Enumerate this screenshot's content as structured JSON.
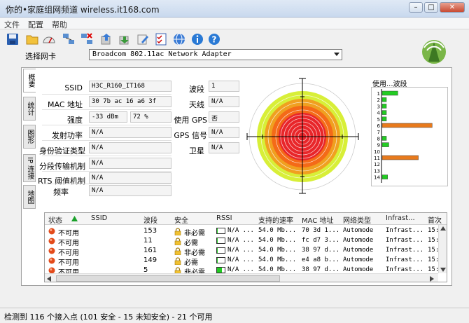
{
  "window": {
    "title": "你的•家庭组网频道 wireless.it168.com",
    "buttons": [
      "–",
      "□",
      "✕"
    ]
  },
  "menu": [
    "文件",
    "配置",
    "帮助"
  ],
  "toolbar_icons": [
    "save-icon",
    "open-folder-icon",
    "gauge-icon",
    "network-icon",
    "network-x-icon",
    "export-icon",
    "import-icon",
    "edit-icon",
    "checklist-icon",
    "globe-icon",
    "info-icon",
    "help-icon"
  ],
  "adapter": {
    "label": "选择网卡",
    "value": "Broadcom 802.11ac Network Adapter"
  },
  "side_tabs": [
    "概要",
    "统计",
    "图形",
    "IP 连接",
    "地图"
  ],
  "fields_left": [
    {
      "label": "SSID",
      "value": "H3C_R160_IT168"
    },
    {
      "label": "MAC 地址",
      "value": "30 7b ac 16 a6 3f"
    },
    {
      "label": "强度",
      "value": "-33 dBm",
      "value2": "72 %"
    },
    {
      "label": "发射功率",
      "value": "N/A"
    },
    {
      "label": "身份验证类型",
      "value": "N/A"
    },
    {
      "label": "分段传输机制",
      "value": "N/A"
    },
    {
      "label": "RTS 阈值机制",
      "value": "N/A"
    },
    {
      "label": "频率",
      "value": "N/A"
    }
  ],
  "fields_right": [
    {
      "label": "波段",
      "value": "1"
    },
    {
      "label": "天线",
      "value": "N/A"
    },
    {
      "label": "使用 GPS",
      "value": "否"
    },
    {
      "label": "GPS 信号",
      "value": "N/A"
    },
    {
      "label": "卫星",
      "value": "N/A"
    }
  ],
  "usage": {
    "title": "使用...波段",
    "channels": [
      "1",
      "2",
      "3",
      "4",
      "5",
      "6",
      "7",
      "8",
      "9",
      "10",
      "11",
      "12",
      "13",
      "14"
    ],
    "levels": [
      0.26,
      0.07,
      0.07,
      0.07,
      0.07,
      0.83,
      0.0,
      0.07,
      0.11,
      0.0,
      0.6,
      0.0,
      0.0,
      0.09
    ],
    "colors": [
      "#22cc22",
      "#22cc22",
      "#22cc22",
      "#22cc22",
      "#22cc22",
      "#e87a1c",
      "#22cc22",
      "#22cc22",
      "#22cc22",
      "#22cc22",
      "#e87a1c",
      "#22cc22",
      "#22cc22",
      "#22cc22"
    ]
  },
  "table": {
    "columns": [
      "状态",
      "SSID",
      "波段",
      "安全",
      "RSSI",
      "支持的速率",
      "MAC 地址",
      "网络类型",
      "Infrast...",
      "首次"
    ],
    "rows": [
      {
        "status": "不可用",
        "ssid": "",
        "channel": "153",
        "security": "非必需",
        "rssi": "N/A ...",
        "rssi_level": 0.1,
        "rate": "54.0 Mb...",
        "mac": "70 3d 1...",
        "type": "Automode",
        "infra": "Infrast...",
        "first": "15:"
      },
      {
        "status": "不可用",
        "ssid": "",
        "channel": "11",
        "security": "必需",
        "rssi": "N/A ...",
        "rssi_level": 0.05,
        "rate": "54.0 Mb...",
        "mac": "fc d7 3...",
        "type": "Automode",
        "infra": "Infrast...",
        "first": "15:"
      },
      {
        "status": "不可用",
        "ssid": "",
        "channel": "161",
        "security": "非必需",
        "rssi": "N/A ...",
        "rssi_level": 0.05,
        "rate": "54.0 Mb...",
        "mac": "38 97 d...",
        "type": "Automode",
        "infra": "Infrast...",
        "first": "15:"
      },
      {
        "status": "不可用",
        "ssid": "",
        "channel": "149",
        "security": "必需",
        "rssi": "N/A ...",
        "rssi_level": 0.1,
        "rate": "54.0 Mb...",
        "mac": "e4 a8 b...",
        "type": "Automode",
        "infra": "Infrast...",
        "first": "15:"
      },
      {
        "status": "不可用",
        "ssid": "",
        "channel": "5",
        "security": "非必需",
        "rssi": "N/A ...",
        "rssi_level": 0.6,
        "rate": "54.0 Mb...",
        "mac": "38 97 d...",
        "type": "Automode",
        "infra": "Infrast...",
        "first": "15:"
      }
    ]
  },
  "status_bar": "检测到 116 个接入点 (101 安全 - 15 未知安全) - 21 个可用",
  "colors": {
    "accent_green": "#22cc22",
    "accent_orange": "#e87a1c",
    "status_red": "#e34a1a"
  }
}
